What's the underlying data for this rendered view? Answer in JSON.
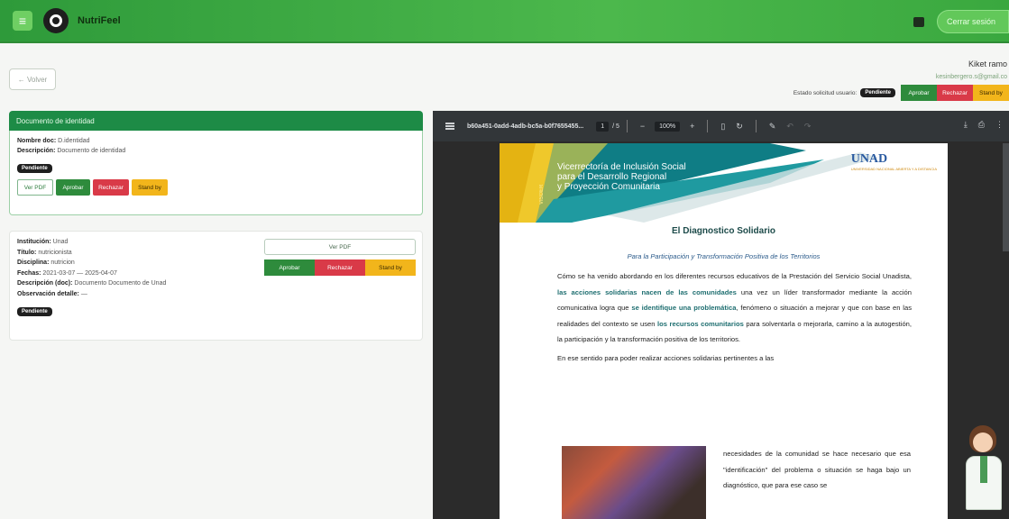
{
  "app": {
    "brand": "NutriFeel",
    "logout_label": "Cerrar sesión"
  },
  "nav": {
    "back_label": "← Volver"
  },
  "user": {
    "name": "Kiket ramo",
    "email": "kesinbergero.s@gmail.co",
    "status_label": "Estado solicitud usuario:",
    "status_badge": "Pendiente",
    "approve_label": "Aprobar",
    "reject_label": "Rechazar",
    "standby_label": "Stand by"
  },
  "identity_card": {
    "header": "Documento de identidad",
    "name_label": "Nombre doc:",
    "name_value": "D.identidad",
    "desc_label": "Descripción:",
    "desc_value": "Documento de identidad",
    "badge": "Pendiente",
    "view_pdf_label": "Ver PDF",
    "approve_label": "Aprobar",
    "reject_label": "Rechazar",
    "standby_label": "Stand by"
  },
  "education_card": {
    "institution_label": "Institución:",
    "institution_value": "Unad",
    "title_label": "Título:",
    "title_value": "nutricionista",
    "discipline_label": "Disciplina:",
    "discipline_value": "nutricion",
    "dates_label": "Fechas:",
    "dates_value": "2021-03-07 — 2025-04-07",
    "doc_desc_label": "Descripción (doc):",
    "doc_desc_value": "Documento Documento de Unad",
    "observation_label": "Observación detalle:",
    "observation_value": "—",
    "badge": "Pendiente",
    "view_pdf_label": "Ver PDF",
    "approve_label": "Aprobar",
    "reject_label": "Rechazar",
    "standby_label": "Stand by"
  },
  "pdf_viewer": {
    "filename": "b60a451-0add-4adb-bc5a-b0f7655455...",
    "page_current": "1",
    "page_total": "/ 5",
    "zoom": "100%"
  },
  "pdf_page": {
    "banner_line1": "Vicerrectoría de Inclusión Social",
    "banner_line2": "para el Desarrollo Regional",
    "banner_line3": "y Proyección Comunitaria",
    "vertical_tag": "VISDER",
    "logo_text": "UNAD",
    "logo_sub": "UNIVERSIDAD NACIONAL ABIERTA Y A DISTANCIA",
    "title": "El Diagnostico Solidario",
    "subtitle": "Para la Participación y Transformación Positiva de los Territorios",
    "p1_a": "Cómo se ha venido abordando en los diferentes recursos educativos de la Prestación del Servicio Social Unadista, ",
    "p1_hl1": "las acciones solidarias nacen de las comunidades",
    "p1_b": " una vez un líder transformador mediante la acción comunicativa logra que ",
    "p1_hl2": "se identifique una problemática",
    "p1_c": ", fenómeno o situación a mejorar y que con base en las realidades del contexto se usen ",
    "p1_hl3": "los recursos comunitarios",
    "p1_d": " para solventarla o mejorarla, camino a la autogestión, la participación y la transformación positiva de los territorios.",
    "p2": "En ese sentido para poder realizar acciones solidarias pertinentes a las",
    "p3": "necesidades de la comunidad se hace necesario que esa \"identificación\" del problema o situación se haga bajo un diagnóstico, que para ese caso se"
  }
}
